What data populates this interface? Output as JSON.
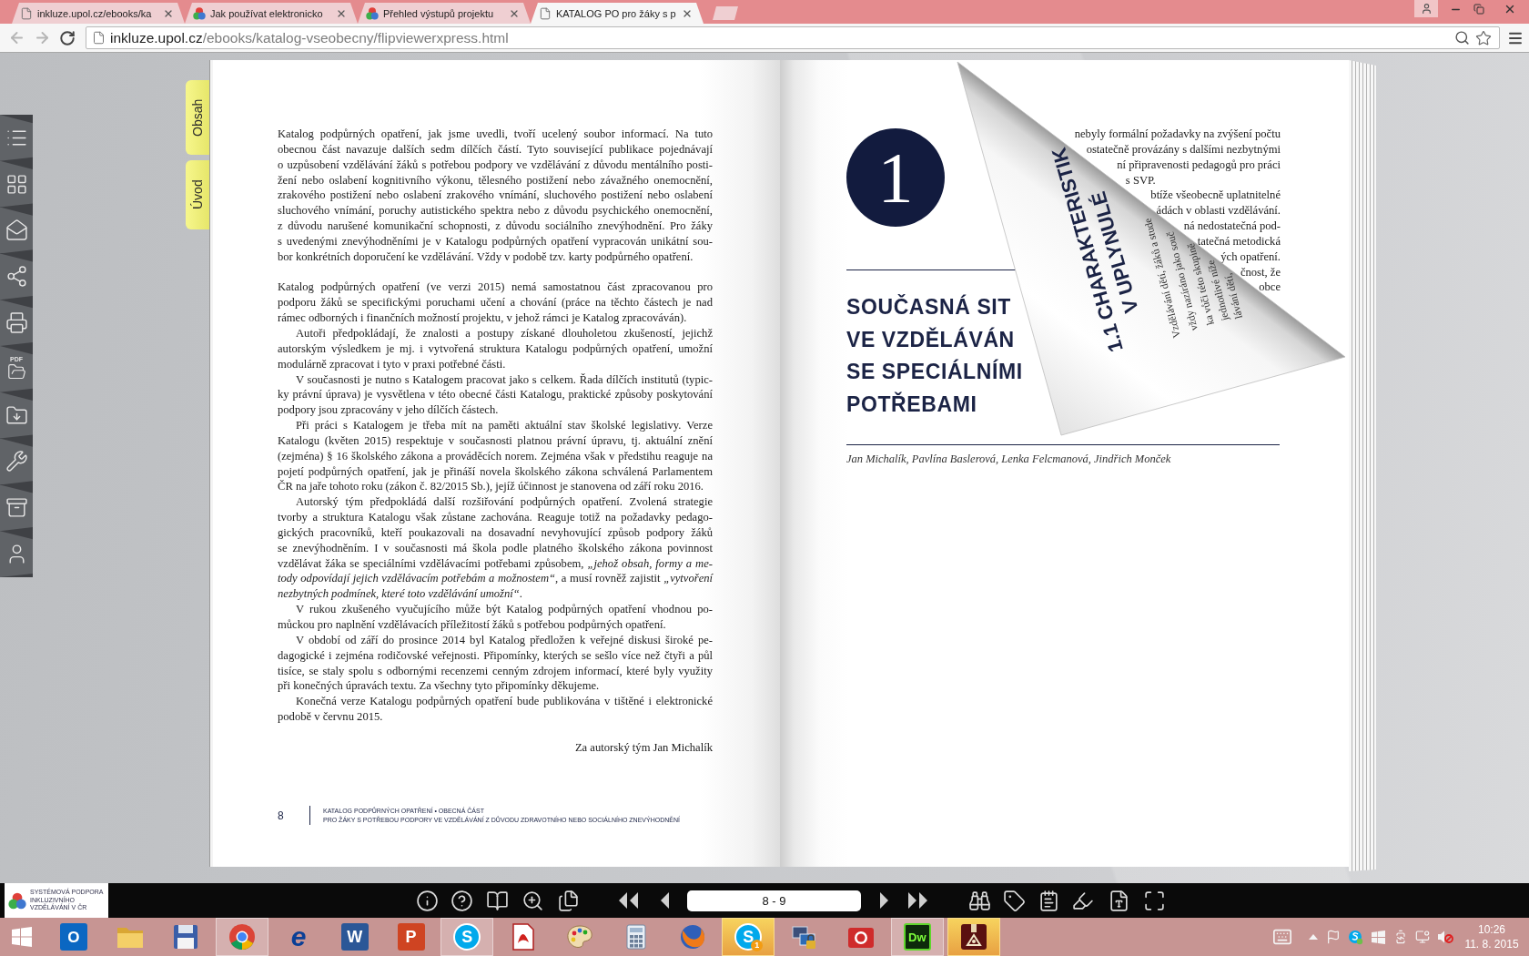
{
  "browser": {
    "tabs": [
      {
        "kind": "page",
        "title": "inkluze.upol.cz/ebooks/ka",
        "selected": false
      },
      {
        "kind": "site",
        "title": "Jak používat elektronicko",
        "selected": false
      },
      {
        "kind": "site",
        "title": "Přehled výstupů projektu",
        "selected": false
      },
      {
        "kind": "page",
        "title": "KATALOG PO pro žáky s p",
        "selected": true
      }
    ],
    "address": {
      "host": "inkluze.upol.cz",
      "path": "/ebooks/katalog-vseobecny/flipviewerxpress.html"
    }
  },
  "viewer": {
    "sidebar": {
      "pdf_label": "PDF"
    },
    "side_tabs": [
      {
        "label": "Obsah"
      },
      {
        "label": "Úvod"
      }
    ],
    "left_page": {
      "sections": [
        {
          "paragraphs": [
            "Katalog podpůrných opatření, jak jsme uvedli, tvoří ucelený soubor informací. Na tuto\nobecnou část navazuje dalších sedm dílčích částí. Tyto související publikace pojednávají\no uzpůsobení vzdělávání žáků s potřebou podpory ve vzdělávání z důvodu mentálního posti-\nžení nebo oslabení kognitivního výkonu, tělesného postižení nebo závažného onemocnění,\nzrakového postižení nebo oslabení zrakového vnímání, sluchového postižení nebo oslabení\nsluchového vnímání, poruchy autistického spektra nebo z důvodu psychického onemocnění,\nz důvodu narušené komunikační schopnosti, z důvodu sociálního znevýhodnění. Pro žáky\ns uvedenými znevýhodněními je v Katalogu podpůrných opatření vypracován unikátní sou-\nbor konkrétních doporučení ke vzdělávání. Vždy v podobě tzv. karty podpůrného opatření."
          ]
        },
        {
          "paragraphs": [
            "Katalog podpůrných opatření (ve verzi 2015) nemá samostatnou část zpracovanou pro\npodporu žáků se specifickými poruchami učení a chování (práce na těchto částech je nad\nrámec odborných i finančních možností projektu, v jehož rámci je Katalog zpracováván).",
            "Autoři předpokládají, že znalosti a postupy získané dlouholetou zkušeností, jejichž\nautorským výsledkem je mj. i vytvořená struktura Katalogu podpůrných opatření, umožní\nmodulárně zpracovat i tyto v praxi potřebné části.",
            "V současnosti je nutno s Katalogem pracovat jako s celkem. Řada dílčích institutů (typic-\nky právní úprava) je vysvětlena v této obecné části Katalogu, praktické způsoby poskytování\npodpory jsou zpracovány v jeho dílčích částech.",
            "Při práci s Katalogem je třeba mít na paměti aktuální stav školské legislativy. Verze\nKatalogu (květen 2015) respektuje v současnosti platnou právní úpravu, tj. aktuální znění\n(zejména) § 16 školského zákona a prováděcích norem. Zejména však v předstihu reaguje na\npojetí podpůrných opatření, jak je přináší novela školského zákona schválená Parlamentem\nČR na jaře tohoto roku (zákon č. 82/2015 Sb.), jejíž účinnost je stanovena od září roku 2016.",
            "Autorský tým předpokládá další rozšiřování podpůrných opatření. Zvolená strategie\ntvorby a struktura Katalogu však zůstane zachována. Reaguje totiž na požadavky pedago-\ngických pracovníků, kteří poukazovali na dosavadní nevyhovující způsob podpory žáků\nse znevýhodněním. I v současnosti má škola podle platného školského zákona povinnost\nvzdělávat žáka se speciálními vzdělávacími potřebami způsobem, *„jehož obsah, formy a me-*\n*tody odpovídají jejich vzdělávacím potřebám a možnostem“*, a musí rovněž zajistit *„vytvoření*\n*nezbytných podmínek, které toto vzdělávání umožní“*.",
            "V rukou zkušeného vyučujícího může být Katalog podpůrných opatření vhodnou po-\nmůckou pro naplnění vzdělávacích příležitostí žáků s potřebou podpůrných opatření.",
            "V období od září do prosince 2014 byl Katalog předložen k veřejné diskusi široké pe-\ndagogické i zejména rodičovské veřejnosti. Připomínky, kterých se sešlo více než čtyři a půl\ntisíce, se staly spolu s odbornými recenzemi cenným zdrojem informací, které byly využity\npři konečných úpravách textu. Za všechny tyto připomínky děkujeme.",
            "Konečná verze Katalogu podpůrných opatření bude publikována v tištěné i elektronické\npodobě v červnu 2015."
          ]
        }
      ],
      "signature": "Za autorský tým Jan Michalík",
      "page_number": "8",
      "running_head": [
        "KATALOG PODPŮRNÝCH OPATŘENÍ • OBECNÁ ČÁST",
        "PRO ŽÁKY S POTŘEBOU PODPORY VE VZDĚLÁVÁNÍ Z DŮVODU ZDRAVOTNÍHO NEBO SOCIÁLNÍHO ZNEVÝHODNĚNÍ"
      ]
    },
    "right_page": {
      "chapter_number": "1",
      "heading_lines": [
        "SOUČASNÁ SIT",
        "VE VZDĚLÁVÁN",
        "SE SPECIÁLNÍMI",
        "POTŘEBAMI"
      ],
      "authors": "Jan Michalík, Pavlína Baslerová, Lenka Felcmanová, Jindřich Monček",
      "revealed_lines": [
        {
          "text": "nebyly formální požadavky na zvýšení počtu",
          "last_line": false
        },
        {
          "text": "ostatečně provázány s dalšími nezbytnými",
          "last_line": false
        },
        {
          "text": "ní připravenosti pedagogů pro práci",
          "last_line": false
        },
        {
          "text": "s SVP.",
          "last_line": true
        },
        {
          "text": "btíže všeobecně uplatnitelné",
          "last_line": false
        },
        {
          "text": "ádách v oblasti vzdělávání.",
          "last_line": false
        },
        {
          "text": "ná nedostatečná pod-",
          "last_line": false
        },
        {
          "text": "tatečná metodická",
          "last_line": false
        },
        {
          "text": "ých opatření.",
          "last_line": false
        },
        {
          "text": "čnost, že",
          "last_line": false
        },
        {
          "text": "obce",
          "last_line": false
        }
      ],
      "curl": {
        "heading_lines": [
          "1.1 CHARAKTERISTIK",
          "V UPLYNULÉ"
        ],
        "body_lines": [
          "Vzdělávání dětí, žáků a stude",
          "vždy nazíráno jako souč",
          "ka vůči této skupině",
          "jednotlivé níže",
          "lávání dětí,"
        ]
      }
    },
    "toolbar": {
      "logo_lines": [
        "SYSTÉMOVÁ PODPORA",
        "INKLUZIVNÍHO",
        "VZDĚLÁVÁNÍ V ČR"
      ],
      "page_field": "8 - 9"
    }
  },
  "taskbar": {
    "apps": [
      {
        "kind": "mail",
        "glyph": "O",
        "running": false,
        "flashing": false
      },
      {
        "kind": "folder",
        "running": false,
        "flashing": false
      },
      {
        "kind": "disk",
        "running": false,
        "flashing": false
      },
      {
        "kind": "browser",
        "running": true,
        "flashing": false
      },
      {
        "kind": "globe",
        "glyph": "e",
        "running": false,
        "flashing": false
      },
      {
        "kind": "document",
        "glyph": "W",
        "running": false,
        "flashing": false
      },
      {
        "kind": "slides",
        "glyph": "P",
        "running": false,
        "flashing": false
      },
      {
        "kind": "chat",
        "glyph": "S",
        "running": true,
        "flashing": false
      },
      {
        "kind": "pdf",
        "running": false,
        "flashing": false
      },
      {
        "kind": "palette",
        "running": false,
        "flashing": false
      },
      {
        "kind": "calculator",
        "running": false,
        "flashing": false
      },
      {
        "kind": "fox",
        "running": false,
        "flashing": false
      },
      {
        "kind": "chat",
        "glyph": "S",
        "badge": "1",
        "running": false,
        "flashing": true
      },
      {
        "kind": "network",
        "running": false,
        "flashing": false
      },
      {
        "kind": "camera",
        "running": false,
        "flashing": false
      },
      {
        "kind": "editor",
        "glyph": "Dw",
        "running": true,
        "flashing": false
      },
      {
        "kind": "box",
        "running": false,
        "flashing": true
      }
    ],
    "clock": {
      "time": "10:26",
      "date": "11. 8. 2015"
    }
  }
}
